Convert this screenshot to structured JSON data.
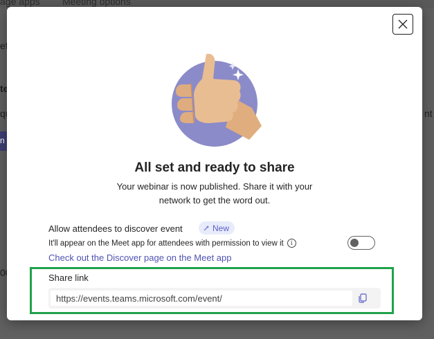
{
  "background": {
    "tab_left": "age apps",
    "tab_right": "Meeting options",
    "left_fragments": [
      "efi",
      "te",
      "qu",
      "n",
      "00"
    ],
    "right_fragment": "nt"
  },
  "dialog": {
    "close_icon": "close-icon",
    "illustration": "thumbs-up-illustration",
    "title": "All set and ready to share",
    "subtitle": "Your webinar is now published. Share it with your network to get the word out.",
    "discover": {
      "label": "Allow attendees to discover event",
      "badge": "New",
      "description": "It'll appear on the Meet app for attendees with permission to view it",
      "toggle_on": false,
      "link": "Check out the Discover page on the Meet app"
    },
    "share": {
      "label": "Share link",
      "url": "https://events.teams.microsoft.com/event/",
      "copy_icon": "copy-icon"
    }
  },
  "colors": {
    "accent": "#5b5fc7",
    "link": "#4f52b2",
    "highlight": "#1fa24a",
    "illustration_bg": "#8b8bc9"
  }
}
